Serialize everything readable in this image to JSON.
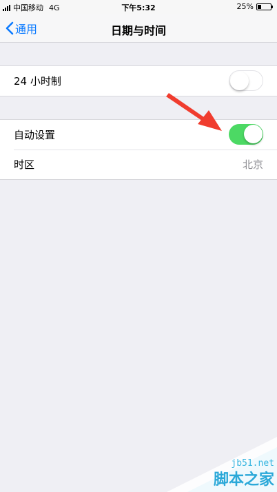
{
  "status_bar": {
    "carrier": "中国移动",
    "network": "4G",
    "time": "下午5:32",
    "battery_text": "25%",
    "battery_level": 0.25
  },
  "nav": {
    "back_label": "通用",
    "title": "日期与时间"
  },
  "settings": {
    "hour24": {
      "label": "24 小时制",
      "enabled": false
    },
    "auto_set": {
      "label": "自动设置",
      "enabled": true
    },
    "timezone": {
      "label": "时区",
      "value": "北京"
    }
  },
  "colors": {
    "accent": "#0a7aff",
    "toggle_on": "#4cd964",
    "arrow": "#f03c2e",
    "background": "#efeff4"
  },
  "watermark": {
    "domain": "jb51.net",
    "name": "脚本之家"
  }
}
